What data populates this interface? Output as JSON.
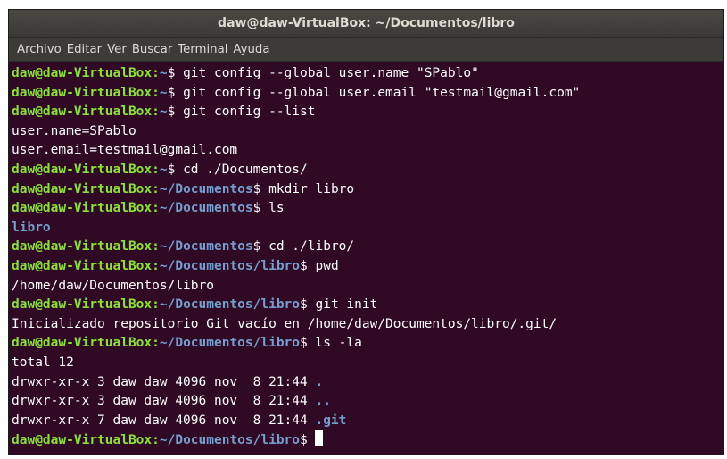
{
  "window": {
    "title": "daw@daw-VirtualBox: ~/Documentos/libro"
  },
  "menu": {
    "items": [
      "Archivo",
      "Editar",
      "Ver",
      "Buscar",
      "Terminal",
      "Ayuda"
    ]
  },
  "colors": {
    "background": "#300a24",
    "prompt_user": "#8ae234",
    "prompt_path": "#729fcf",
    "text": "#ffffff"
  },
  "terminal": {
    "lines": [
      {
        "type": "prompt",
        "user": "daw@daw-VirtualBox",
        "path": "~",
        "cmd": " git config --global user.name \"SPablo\""
      },
      {
        "type": "prompt",
        "user": "daw@daw-VirtualBox",
        "path": "~",
        "cmd": " git config --global user.email \"testmail@gmail.com\""
      },
      {
        "type": "prompt",
        "user": "daw@daw-VirtualBox",
        "path": "~",
        "cmd": " git config --list"
      },
      {
        "type": "output",
        "text": "user.name=SPablo"
      },
      {
        "type": "output",
        "text": "user.email=testmail@gmail.com"
      },
      {
        "type": "prompt",
        "user": "daw@daw-VirtualBox",
        "path": "~",
        "cmd": " cd ./Documentos/"
      },
      {
        "type": "prompt",
        "user": "daw@daw-VirtualBox",
        "path": "~/Documentos",
        "cmd": " mkdir libro"
      },
      {
        "type": "prompt",
        "user": "daw@daw-VirtualBox",
        "path": "~/Documentos",
        "cmd": " ls"
      },
      {
        "type": "dir",
        "text": "libro"
      },
      {
        "type": "prompt",
        "user": "daw@daw-VirtualBox",
        "path": "~/Documentos",
        "cmd": " cd ./libro/"
      },
      {
        "type": "prompt",
        "user": "daw@daw-VirtualBox",
        "path": "~/Documentos/libro",
        "cmd": " pwd"
      },
      {
        "type": "output",
        "text": "/home/daw/Documentos/libro"
      },
      {
        "type": "prompt",
        "user": "daw@daw-VirtualBox",
        "path": "~/Documentos/libro",
        "cmd": " git init"
      },
      {
        "type": "output",
        "text": "Inicializado repositorio Git vacío en /home/daw/Documentos/libro/.git/"
      },
      {
        "type": "prompt",
        "user": "daw@daw-VirtualBox",
        "path": "~/Documentos/libro",
        "cmd": " ls -la"
      },
      {
        "type": "output",
        "text": "total 12"
      },
      {
        "type": "listing",
        "text": "drwxr-xr-x 3 daw daw 4096 nov  8 21:44 ",
        "name": "."
      },
      {
        "type": "listing",
        "text": "drwxr-xr-x 3 daw daw 4096 nov  8 21:44 ",
        "name": ".."
      },
      {
        "type": "listing",
        "text": "drwxr-xr-x 7 daw daw 4096 nov  8 21:44 ",
        "name": ".git"
      },
      {
        "type": "prompt",
        "user": "daw@daw-VirtualBox",
        "path": "~/Documentos/libro",
        "cmd": " ",
        "cursor": true
      }
    ]
  }
}
